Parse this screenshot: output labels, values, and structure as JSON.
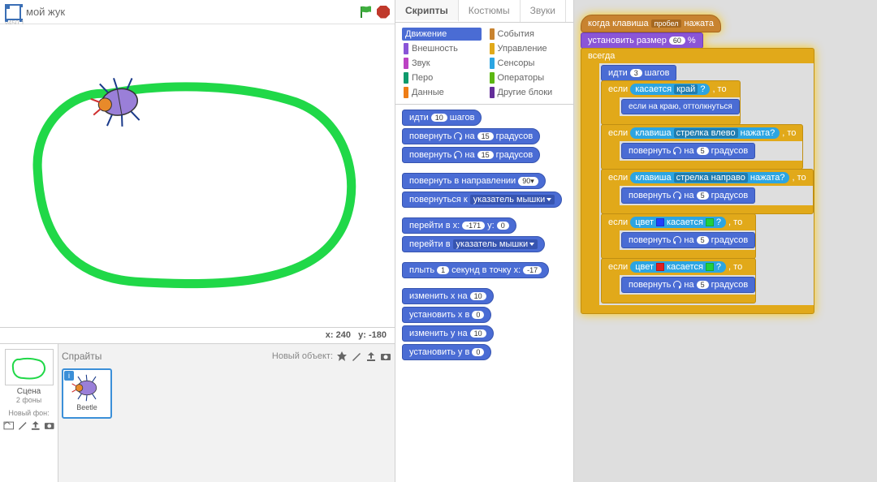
{
  "header": {
    "version": "v450.1",
    "sprite_title": "мой жук"
  },
  "coords": {
    "label_x": "x:",
    "val_x": "240",
    "label_y": "y:",
    "val_y": "-180"
  },
  "sprite_panel": {
    "sprites_label": "Спрайты",
    "new_object_label": "Новый объект:",
    "stage_label": "Сцена",
    "stage_sub": "2 фоны",
    "new_bg_label": "Новый фон:",
    "sprite_name": "Beetle"
  },
  "tabs": {
    "scripts": "Скрипты",
    "costumes": "Костюмы",
    "sounds": "Звуки"
  },
  "categories": [
    {
      "label": "Движение",
      "color": "#4a6cd4",
      "active": true
    },
    {
      "label": "События",
      "color": "#c88330"
    },
    {
      "label": "Внешность",
      "color": "#8a55d7"
    },
    {
      "label": "Управление",
      "color": "#e1a91a"
    },
    {
      "label": "Звук",
      "color": "#bb42c3"
    },
    {
      "label": "Сенсоры",
      "color": "#2ca5e2"
    },
    {
      "label": "Перо",
      "color": "#0e9a6c"
    },
    {
      "label": "Операторы",
      "color": "#5cb712"
    },
    {
      "label": "Данные",
      "color": "#ee7d16"
    },
    {
      "label": "Другие блоки",
      "color": "#632d99"
    }
  ],
  "palette": {
    "move": {
      "a": "идти",
      "n": "10",
      "b": "шагов"
    },
    "turn_cw": {
      "a": "повернуть",
      "n": "15",
      "b": "градусов"
    },
    "turn_ccw": {
      "a": "повернуть",
      "n": "15",
      "b": "градусов"
    },
    "point_dir": {
      "a": "повернуть в направлении",
      "n": "90▾"
    },
    "point_towards": {
      "a": "повернуться к",
      "dd": "указатель мышки"
    },
    "goto_xy": {
      "a": "перейти в x:",
      "x": "-171",
      "b": "y:",
      "y": "0"
    },
    "goto": {
      "a": "перейти в",
      "dd": "указатель мышки"
    },
    "glide": {
      "a": "плыть",
      "n": "1",
      "b": "секунд в точку x:",
      "x": "-17"
    },
    "change_x": {
      "a": "изменить x на",
      "n": "10"
    },
    "set_x": {
      "a": "установить x в",
      "n": "0"
    },
    "change_y": {
      "a": "изменить y на",
      "n": "10"
    },
    "set_y": {
      "a": "установить y в",
      "n": "0"
    }
  },
  "script": {
    "hat": {
      "a": "когда клавиша",
      "dd": "пробел",
      "b": "нажата"
    },
    "set_size": {
      "a": "установить размер",
      "n": "60",
      "b": "%"
    },
    "forever": "всегда",
    "move": {
      "a": "идти",
      "n": "3",
      "b": "шагов"
    },
    "if": "если",
    "then": ", то",
    "touch_edge": {
      "a": "касается",
      "dd": "край",
      "q": "?"
    },
    "bounce": "если на краю, оттолкнуться",
    "key_left": {
      "a": "клавиша",
      "dd": "стрелка влево",
      "b": "нажата?"
    },
    "key_right": {
      "a": "клавиша",
      "dd": "стрелка направо",
      "b": "нажата?"
    },
    "turn5": {
      "a": "повернуть",
      "n": "5",
      "b": "градусов"
    },
    "color_touch": {
      "a": "цвет",
      "b": "касается",
      "q": "?"
    },
    "c_blue": "#2040ff",
    "c_red": "#e02020",
    "c_green": "#20d040"
  }
}
